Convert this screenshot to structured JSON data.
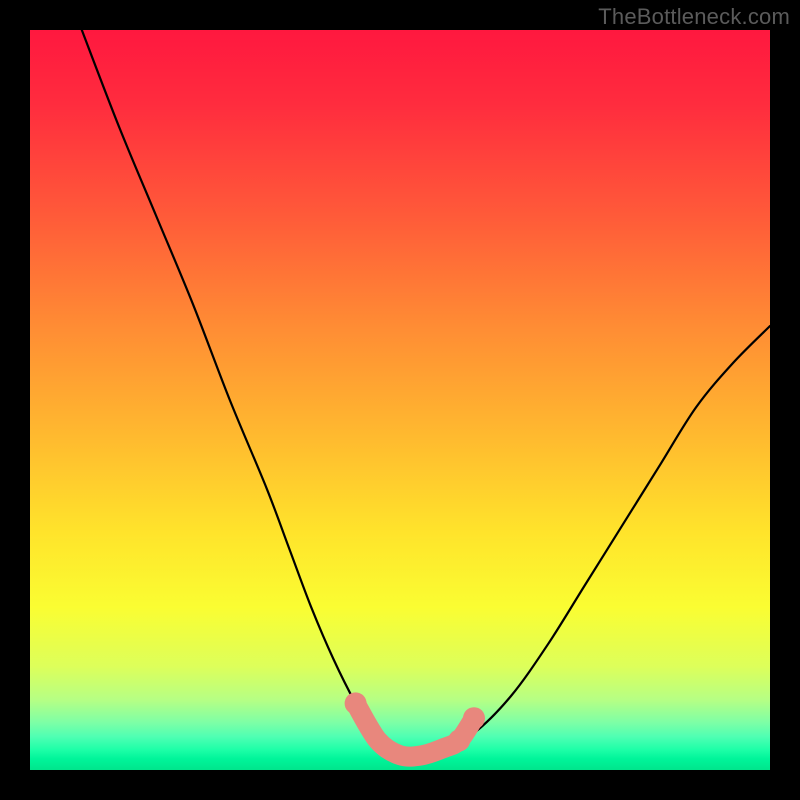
{
  "attribution": "TheBottleneck.com",
  "colors": {
    "black": "#000000",
    "curve": "#000000",
    "highlight": "#e8877d",
    "gradient_stops": [
      {
        "offset": 0.0,
        "color": "#ff183f"
      },
      {
        "offset": 0.1,
        "color": "#ff2c3e"
      },
      {
        "offset": 0.25,
        "color": "#ff5a39"
      },
      {
        "offset": 0.4,
        "color": "#ff8c34"
      },
      {
        "offset": 0.55,
        "color": "#ffba2f"
      },
      {
        "offset": 0.68,
        "color": "#ffe42b"
      },
      {
        "offset": 0.78,
        "color": "#fafd32"
      },
      {
        "offset": 0.86,
        "color": "#ddff5a"
      },
      {
        "offset": 0.905,
        "color": "#b6ff84"
      },
      {
        "offset": 0.935,
        "color": "#7fffa5"
      },
      {
        "offset": 0.955,
        "color": "#4fffb3"
      },
      {
        "offset": 0.972,
        "color": "#1fffa8"
      },
      {
        "offset": 0.985,
        "color": "#00f59a"
      },
      {
        "offset": 1.0,
        "color": "#00e58c"
      }
    ]
  },
  "chart_data": {
    "type": "line",
    "title": "",
    "xlabel": "",
    "ylabel": "",
    "xlim": [
      0,
      100
    ],
    "ylim": [
      0,
      100
    ],
    "series": [
      {
        "name": "bottleneck-curve",
        "x": [
          7,
          12,
          17,
          22,
          27,
          32,
          35,
          38,
          41,
          44,
          47,
          50,
          53,
          56,
          60,
          65,
          70,
          75,
          80,
          85,
          90,
          95,
          100
        ],
        "y": [
          100,
          87,
          75,
          63,
          50,
          38,
          30,
          22,
          15,
          9,
          4,
          2,
          2,
          3,
          5,
          10,
          17,
          25,
          33,
          41,
          49,
          55,
          60
        ]
      }
    ],
    "highlight": {
      "name": "optimal-range",
      "x": [
        44,
        47,
        50,
        53,
        56,
        58,
        60
      ],
      "y": [
        9,
        4,
        2,
        2,
        3,
        4,
        7
      ]
    }
  }
}
